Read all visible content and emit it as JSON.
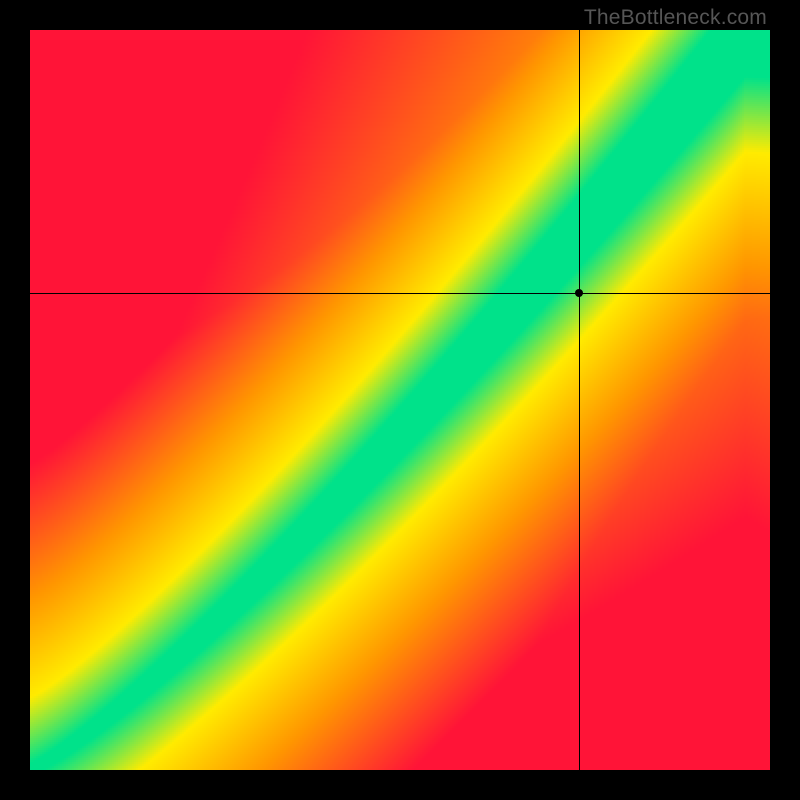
{
  "watermark": "TheBottleneck.com",
  "chart_data": {
    "type": "heatmap",
    "title": "",
    "xlabel": "",
    "ylabel": "",
    "xlim": [
      0,
      1
    ],
    "ylim": [
      0,
      1
    ],
    "marker": {
      "x": 0.742,
      "y": 0.645
    },
    "crosshair": {
      "x": 0.742,
      "y": 0.645
    },
    "ideal_curve_description": "diagonal S-curve band where value is optimal (green)",
    "color_scale": [
      {
        "stop": 0.0,
        "color": "#ff1a2f",
        "meaning": "severe mismatch"
      },
      {
        "stop": 0.35,
        "color": "#ff8a00",
        "meaning": "mismatch"
      },
      {
        "stop": 0.6,
        "color": "#ffe600",
        "meaning": "near match"
      },
      {
        "stop": 1.0,
        "color": "#00e28a",
        "meaning": "balanced"
      }
    ],
    "field_function": "score(x,y) = 1 - clamp(|y - curve(x)| / bandwidth(x))",
    "curve_samples": [
      {
        "x": 0.0,
        "y": 0.0
      },
      {
        "x": 0.1,
        "y": 0.06
      },
      {
        "x": 0.2,
        "y": 0.13
      },
      {
        "x": 0.3,
        "y": 0.22
      },
      {
        "x": 0.4,
        "y": 0.33
      },
      {
        "x": 0.5,
        "y": 0.45
      },
      {
        "x": 0.6,
        "y": 0.57
      },
      {
        "x": 0.7,
        "y": 0.7
      },
      {
        "x": 0.8,
        "y": 0.82
      },
      {
        "x": 0.9,
        "y": 0.92
      },
      {
        "x": 1.0,
        "y": 1.0
      }
    ],
    "grid": false,
    "legend": false
  },
  "colors": {
    "background": "#000000",
    "watermark": "#565656"
  }
}
